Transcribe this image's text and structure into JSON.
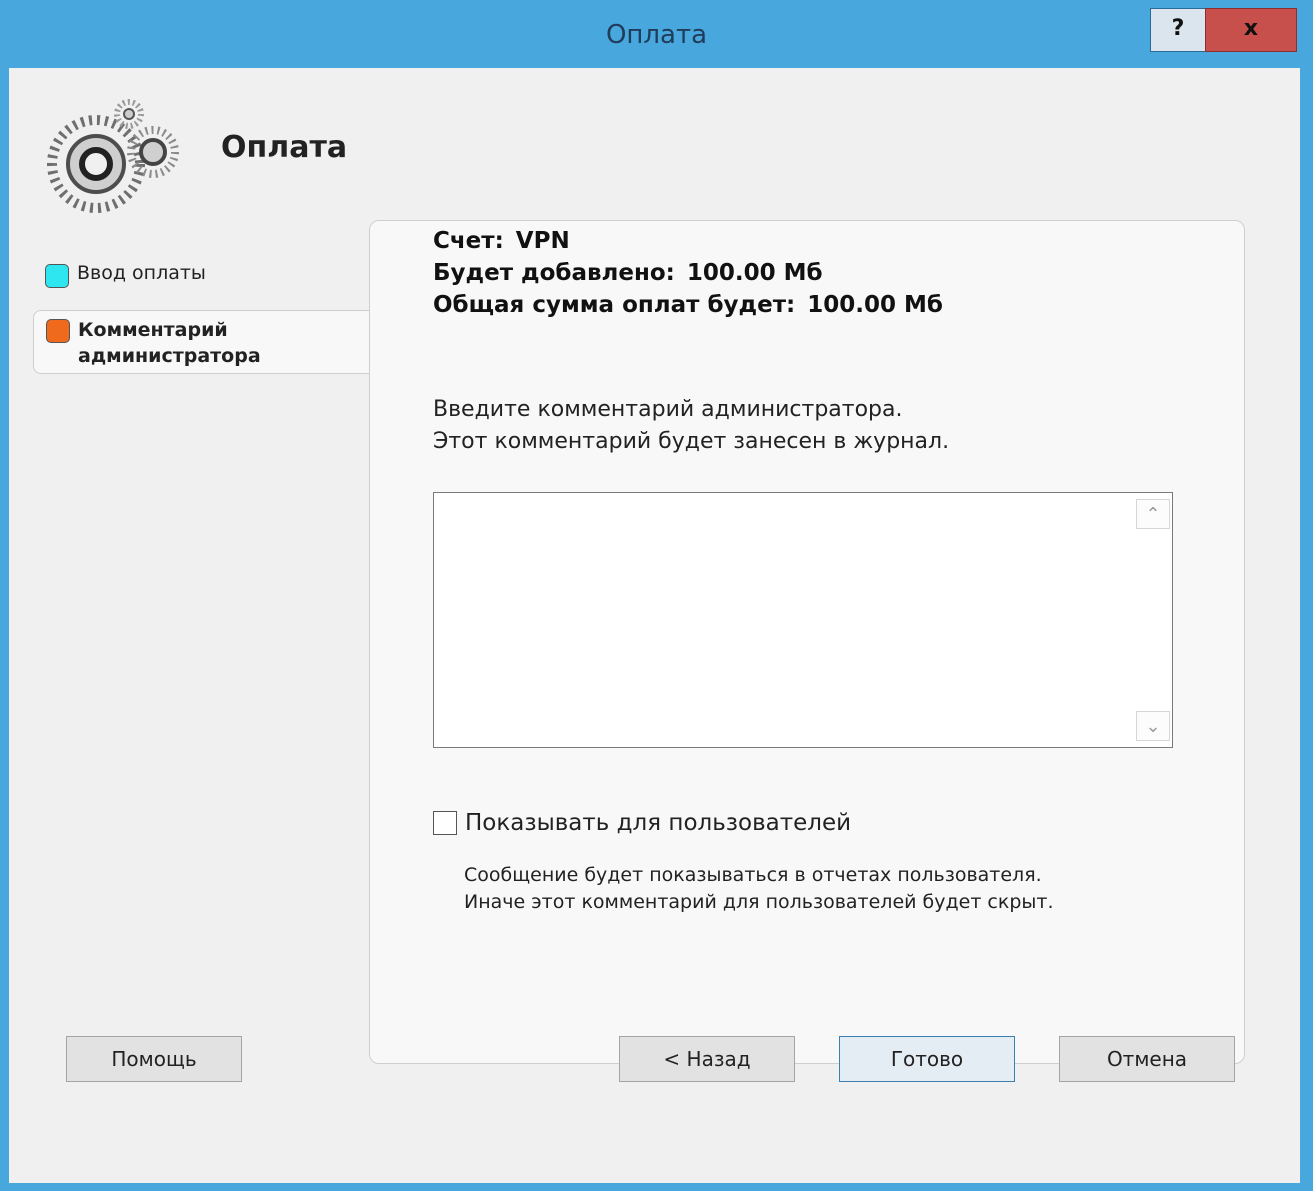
{
  "window": {
    "title": "Оплата",
    "help_label": "?",
    "close_label": "x"
  },
  "header": {
    "title": "Оплата",
    "icon": "gears-icon"
  },
  "steps": [
    {
      "label": "Ввод оплаты",
      "color": "#2ee6f0",
      "active": false
    },
    {
      "label": "Комментарий администратора",
      "color": "#f06a1d",
      "active": true
    }
  ],
  "summary": {
    "account_label": "Счет:",
    "account_value": "VPN",
    "added_label": "Будет добавлено:",
    "added_value": "100.00 Мб",
    "total_label": "Общая сумма оплат будет:",
    "total_value": "100.00 Мб"
  },
  "comment": {
    "prompt_line1": "Введите комментарий администратора.",
    "prompt_line2": "Этот комментарий будет занесен в журнал.",
    "value": ""
  },
  "show_users": {
    "label": "Показывать для пользователей",
    "checked": false,
    "note_line1": "Сообщение будет показываться в отчетах пользователя.",
    "note_line2": "Иначе этот комментарий для пользователей будет скрыт."
  },
  "buttons": {
    "help": "Помощь",
    "back": "< Назад",
    "finish": "Готово",
    "cancel": "Отмена"
  }
}
